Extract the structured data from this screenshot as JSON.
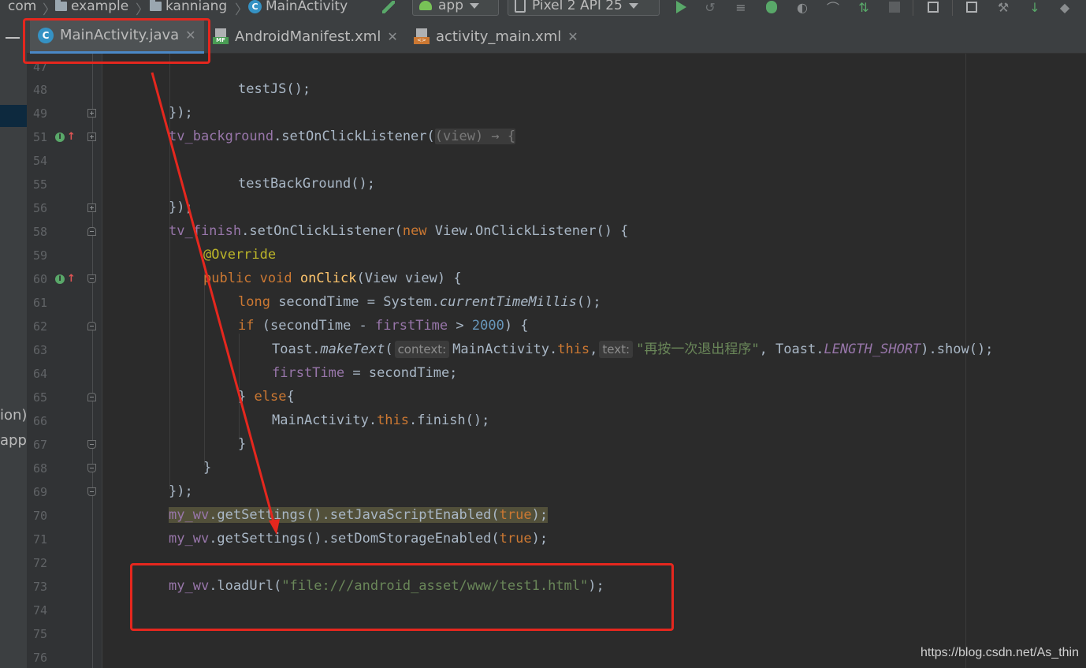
{
  "breadcrumb": {
    "items": [
      "com",
      "example",
      "kanniang",
      "MainActivity"
    ]
  },
  "toolbar": {
    "run_config": "app",
    "device": "Pixel 2 API 25",
    "icons": [
      "hammer-icon",
      "run-icon",
      "apply-changes-icon",
      "coverage-icon",
      "debug-icon",
      "profile-icon",
      "attach-debugger-icon",
      "stop-icon",
      "sync-icon",
      "avd-manager-icon",
      "sdk-manager-icon",
      "device-file-icon"
    ]
  },
  "project_panel": {
    "fragments": [
      "ion)",
      "app"
    ]
  },
  "tabs": [
    {
      "label": "MainActivity.java",
      "icon": "java-class-icon",
      "active": true
    },
    {
      "label": "AndroidManifest.xml",
      "icon": "manifest-file-icon",
      "active": false
    },
    {
      "label": "activity_main.xml",
      "icon": "layout-xml-icon",
      "active": false
    }
  ],
  "gutter": {
    "line_numbers": [
      "47",
      "48",
      "49",
      "51",
      "54",
      "55",
      "56",
      "58",
      "59",
      "60",
      "61",
      "62",
      "63",
      "64",
      "65",
      "66",
      "67",
      "68",
      "69",
      "70",
      "71",
      "72",
      "73",
      "74",
      "75",
      "76"
    ]
  },
  "code": {
    "l48": "testJS();",
    "l49": "});",
    "l51_obj": "tv_background",
    "l51_call": ".setOnClickListener(",
    "l51_lambda": "(view) → {",
    "l55": "testBackGround();",
    "l56": "});",
    "l58_obj": "tv_finish",
    "l58_call": ".setOnClickListener(",
    "l58_new": "new",
    "l58_type": " View.OnClickListener() {",
    "l59": "@Override",
    "l60_kw": "public void",
    "l60_m": "onClick",
    "l60_rest": "(View view) {",
    "l61_kw": "long",
    "l61_a": " secondTime = System.",
    "l61_m": "currentTimeMillis",
    "l61_b": "();",
    "l62_kw": "if",
    "l62_a": " (secondTime - ",
    "l62_f": "firstTime",
    "l62_b": " > ",
    "l62_n": "2000",
    "l62_c": ") {",
    "l63_a": "Toast.",
    "l63_m": "makeText",
    "l63_b": "(",
    "l63_hint1": "context:",
    "l63_c": "MainActivity.",
    "l63_this": "this",
    "l63_d": ",",
    "l63_hint2": "text:",
    "l63_str": "\"再按一次退出程序\"",
    "l63_e": ", Toast.",
    "l63_const": "LENGTH_SHORT",
    "l63_f": ").show();",
    "l64_f": "firstTime",
    "l64_a": " = secondTime;",
    "l65_a": "} ",
    "l65_kw": "else",
    "l65_b": "{",
    "l66_a": "MainActivity.",
    "l66_this": "this",
    "l66_b": ".finish();",
    "l67": "}",
    "l68": "}",
    "l69": "});",
    "l70_f": "my_wv",
    "l70_a": ".getSettings().setJavaScriptEnabled(",
    "l70_true": "true",
    "l70_b": ");",
    "l71_f": "my_wv",
    "l71_a": ".getSettings().setDomStorageEnabled(",
    "l71_true": "true",
    "l71_b": ");",
    "l73_f": "my_wv",
    "l73_a": ".loadUrl(",
    "l73_str": "\"file:///android_asset/www/test1.html\"",
    "l73_b": ");"
  },
  "watermark": "https://blog.csdn.net/As_thin",
  "colors": {
    "keyword": "#cc7832",
    "field": "#9876aa",
    "string": "#6a8759",
    "number": "#6897bb",
    "annotation": "#bbb529",
    "method_decl": "#ffc66d",
    "annotation_box": "#e5271e"
  }
}
